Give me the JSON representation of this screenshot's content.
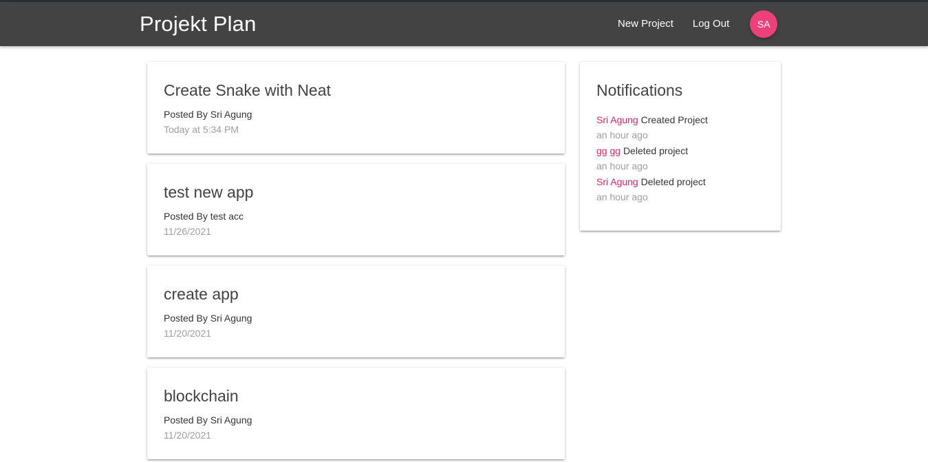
{
  "header": {
    "brand": "Projekt Plan",
    "links": [
      "New Project",
      "Log Out"
    ],
    "avatar_initials": "SA",
    "avatar_color": "#ec407a",
    "bar_color": "#434343"
  },
  "projects": [
    {
      "title": "Create Snake with Neat",
      "posted_by": "Posted By Sri Agung",
      "date": "Today at 5:34 PM"
    },
    {
      "title": "test new app",
      "posted_by": "Posted By test acc",
      "date": "11/26/2021"
    },
    {
      "title": "create app",
      "posted_by": "Posted By Sri Agung",
      "date": "11/20/2021"
    },
    {
      "title": "blockchain",
      "posted_by": "Posted By Sri Agung",
      "date": "11/20/2021"
    }
  ],
  "notifications": {
    "title": "Notifications",
    "items": [
      {
        "user": "Sri Agung",
        "action": "Created Project",
        "time": "an hour ago"
      },
      {
        "user": "gg gg",
        "action": "Deleted project",
        "time": "an hour ago"
      },
      {
        "user": "Sri Agung",
        "action": "Deleted project",
        "time": "an hour ago"
      }
    ]
  }
}
